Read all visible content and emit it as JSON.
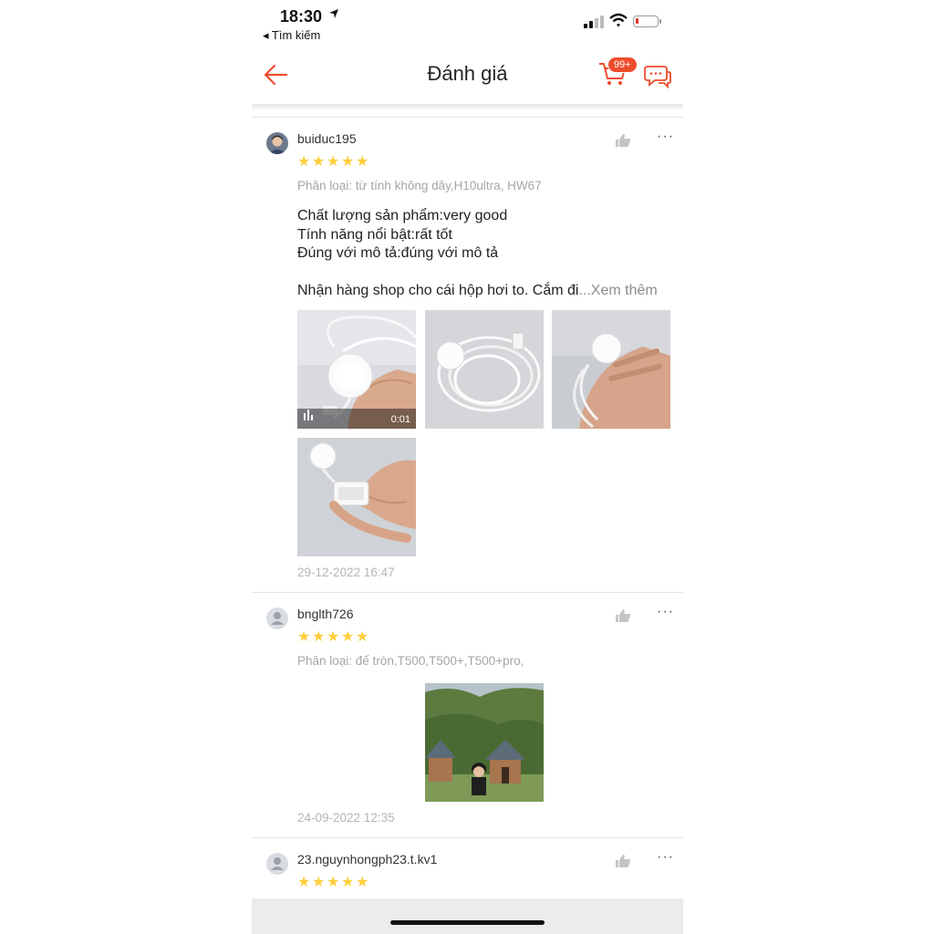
{
  "status_bar": {
    "time": "18:30",
    "back_app": "Tìm kiếm"
  },
  "header": {
    "title": "Đánh giá",
    "cart_badge": "99+"
  },
  "reviews": [
    {
      "username": "buiduc195",
      "rating": 5,
      "variant": "Phân loại: từ tính không dây,H10ultra, HW67",
      "lines": [
        "Chất lượng sản phẩm:very good",
        "Tính năng nổi bật:rất tốt",
        "Đúng với mô tả:đúng với mô tả",
        "",
        "Nhận hàng shop cho cái hộp hơi to. Cắm đi"
      ],
      "see_more": "...Xem thêm",
      "video_duration": "0:01",
      "date": "29-12-2022 16:47"
    },
    {
      "username": "bnglth726",
      "rating": 5,
      "variant": "Phân loại: đế tròn,T500,T500+,T500+pro,",
      "date": "24-09-2022 12:35"
    },
    {
      "username": "23.nguynhongph23.t.kv1",
      "rating": 5
    }
  ],
  "icons": {
    "back": "arrow-left-icon",
    "cart": "cart-icon",
    "chat": "chat-icon",
    "like": "thumbs-up-icon",
    "more": "more-dots-icon",
    "star": "star-icon"
  },
  "colors": {
    "accent": "#ee4d2d",
    "star": "#ffce3d",
    "muted": "#a6a6a6"
  }
}
